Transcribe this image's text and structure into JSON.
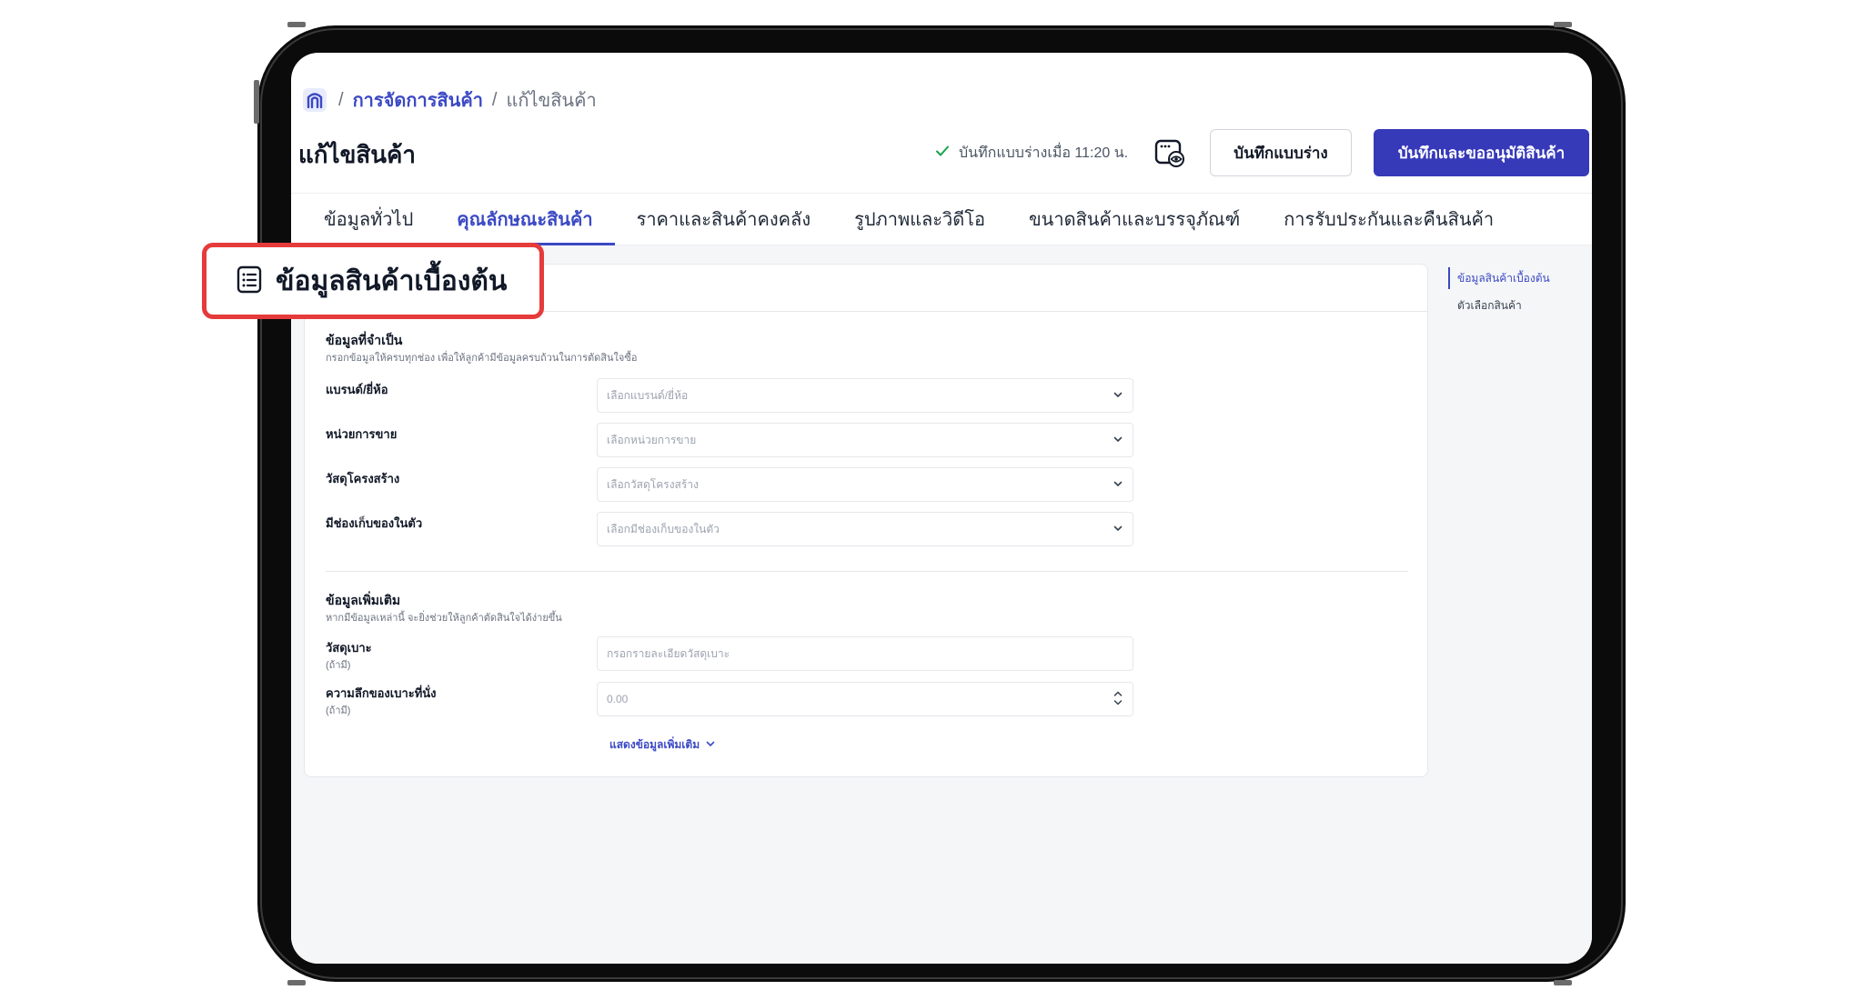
{
  "breadcrumb": {
    "separator": "/",
    "parent": "การจัดการสินค้า",
    "current": "แก้ไขสินค้า"
  },
  "header": {
    "title": "แก้ไขสินค้า",
    "saved_status": "บันทึกแบบร่างเมื่อ 11:20 น.",
    "save_draft_label": "บันทึกแบบร่าง",
    "save_approve_label": "บันทึกและขออนุมัติสินค้า"
  },
  "tabs": [
    {
      "label": "ข้อมูลทั่วไป",
      "active": false
    },
    {
      "label": "คุณลักษณะสินค้า",
      "active": true
    },
    {
      "label": "ราคาและสินค้าคงคลัง",
      "active": false
    },
    {
      "label": "รูปภาพและวิดีโอ",
      "active": false
    },
    {
      "label": "ขนาดสินค้าและบรรจุภัณฑ์",
      "active": false
    },
    {
      "label": "การรับประกันและคืนสินค้า",
      "active": false
    }
  ],
  "card": {
    "title": "ข้อมูลสินค้าเบื้องต้น",
    "required_section": {
      "title": "ข้อมูลที่จำเป็น",
      "subtitle": "กรอกข้อมูลให้ครบทุกช่อง เพื่อให้ลูกค้ามีข้อมูลครบถ้วนในการตัดสินใจซื้อ",
      "fields": [
        {
          "label": "แบรนด์/ยี่ห้อ",
          "placeholder": "เลือกแบรนด์/ยี่ห้อ"
        },
        {
          "label": "หน่วยการขาย",
          "placeholder": "เลือกหน่วยการขาย"
        },
        {
          "label": "วัสดุโครงสร้าง",
          "placeholder": "เลือกวัสดุโครงสร้าง"
        },
        {
          "label": "มีช่องเก็บของในตัว",
          "placeholder": "เลือกมีช่องเก็บของในตัว"
        }
      ]
    },
    "additional_section": {
      "title": "ข้อมูลเพิ่มเติม",
      "subtitle": "หากมีข้อมูลเหล่านี้ จะยิ่งช่วยให้ลูกค้าตัดสินใจได้ง่ายขึ้น",
      "fields": [
        {
          "label": "วัสดุเบาะ",
          "optional": "(ถ้ามี)",
          "placeholder": "กรอกรายละเอียดวัสดุเบาะ"
        },
        {
          "label": "ความลึกของเบาะที่นั่ง",
          "optional": "(ถ้ามี)",
          "value": "0.00"
        }
      ],
      "show_more": "แสดงข้อมูลเพิ่มเติม"
    }
  },
  "anchor_nav": [
    {
      "label": "ข้อมูลสินค้าเบื้องต้น",
      "active": true
    },
    {
      "label": "ตัวเลือกสินค้า",
      "active": false
    }
  ],
  "highlight": {
    "text": "ข้อมูลสินค้าเบื้องต้น",
    "color": "#e63b3b"
  },
  "colors": {
    "accent": "#3b49c4",
    "primary_button": "#3639b8",
    "success": "#16a34a"
  }
}
